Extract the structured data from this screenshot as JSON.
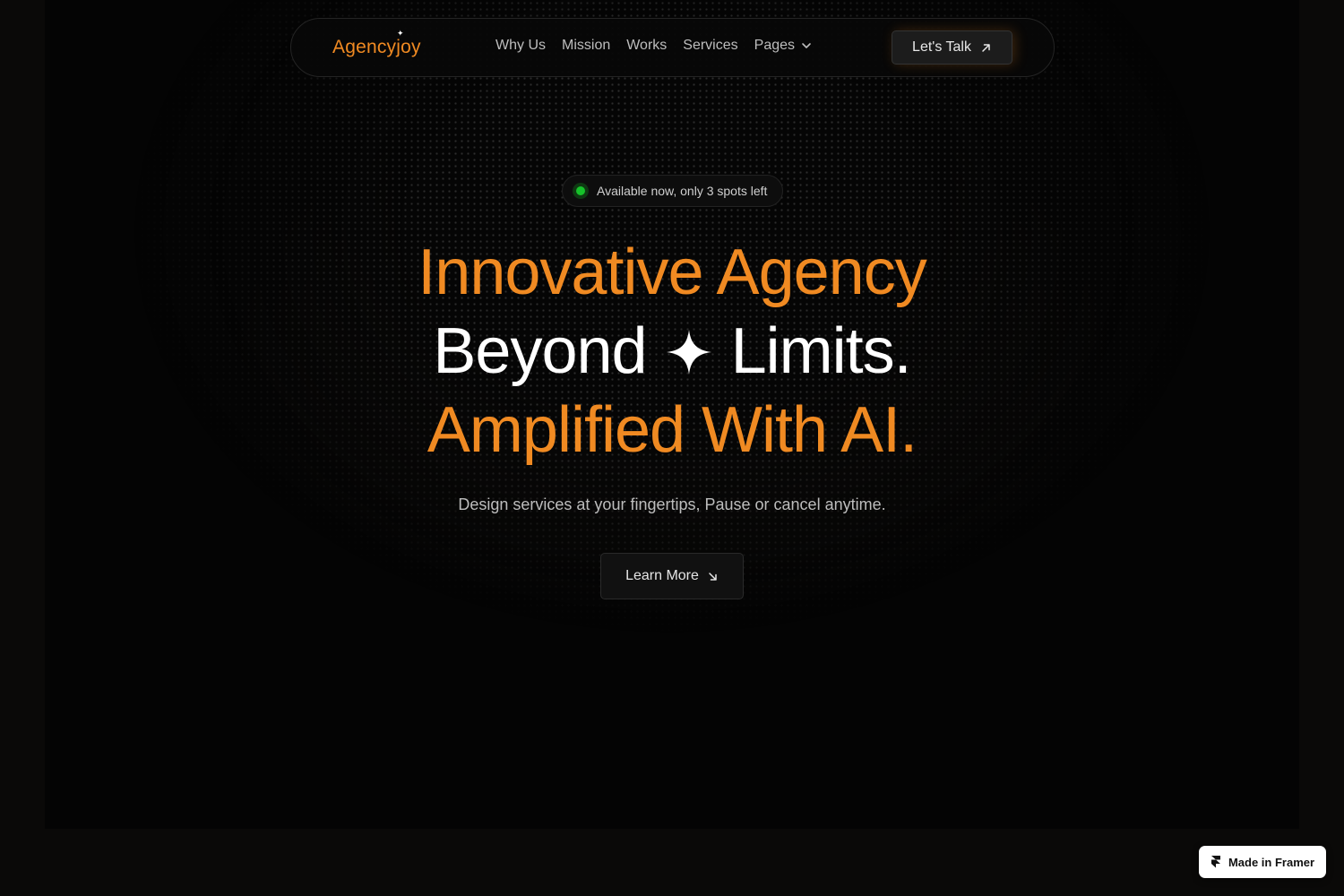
{
  "brand": {
    "name": "Agencyjoy",
    "accent": "#f08a22"
  },
  "nav": {
    "links": [
      "Why Us",
      "Mission",
      "Works",
      "Services",
      "Pages"
    ],
    "cta_label": "Let's Talk"
  },
  "hero": {
    "badge_text": "Available now, only 3 spots left",
    "line1": "Innovative Agency",
    "line2_left": "Beyond",
    "line2_right": "Limits.",
    "line3": "Amplified With AI.",
    "subtitle": "Design services at your fingertips, Pause or cancel anytime.",
    "button_label": "Learn More"
  },
  "framer_badge": {
    "label": "Made in Framer"
  },
  "colors": {
    "status_green": "#16c22a",
    "background": "#040404"
  }
}
